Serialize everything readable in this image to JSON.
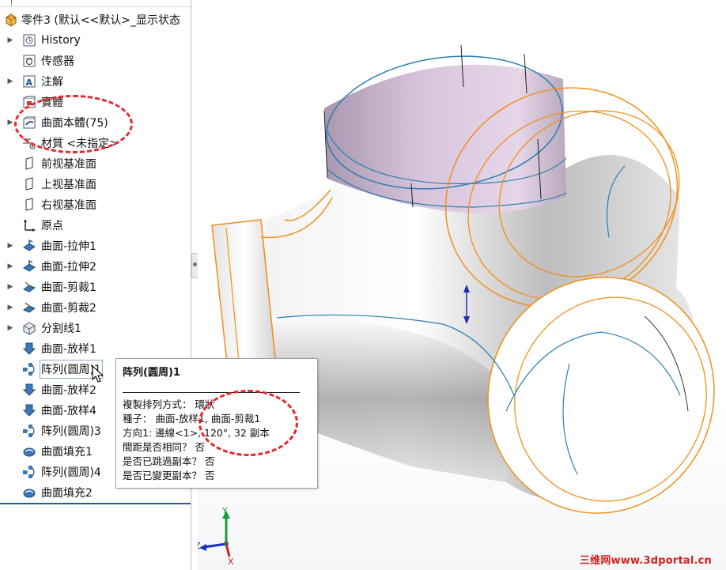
{
  "tree": {
    "root_label": "零件3  (默认<<默认>_显示状态",
    "items": [
      {
        "label": "History",
        "expandable": true,
        "icon": "history-icon"
      },
      {
        "label": "传感器",
        "expandable": false,
        "icon": "sensor-icon"
      },
      {
        "label": "注解",
        "expandable": true,
        "icon": "annotation-icon"
      },
      {
        "label": "實體",
        "expandable": false,
        "icon": "solid-bodies-icon"
      },
      {
        "label": "曲面本體(75)",
        "expandable": true,
        "icon": "surface-bodies-icon"
      },
      {
        "label": "材質 <未指定>",
        "expandable": false,
        "icon": "material-icon"
      },
      {
        "label": "前视基准面",
        "expandable": false,
        "icon": "plane-icon"
      },
      {
        "label": "上视基准面",
        "expandable": false,
        "icon": "plane-icon"
      },
      {
        "label": "右视基准面",
        "expandable": false,
        "icon": "plane-icon"
      },
      {
        "label": "原点",
        "expandable": false,
        "icon": "origin-icon"
      },
      {
        "label": "曲面-拉伸1",
        "expandable": true,
        "icon": "surface-extrude-icon"
      },
      {
        "label": "曲面-拉伸2",
        "expandable": true,
        "icon": "surface-extrude-icon"
      },
      {
        "label": "曲面-剪裁1",
        "expandable": true,
        "icon": "surface-trim-icon"
      },
      {
        "label": "曲面-剪裁2",
        "expandable": true,
        "icon": "surface-trim-icon"
      },
      {
        "label": "分割线1",
        "expandable": true,
        "icon": "split-line-icon"
      },
      {
        "label": "曲面-放样1",
        "expandable": false,
        "icon": "surface-loft-icon"
      },
      {
        "label": "阵列(圆周)1",
        "expandable": false,
        "icon": "circular-pattern-icon"
      },
      {
        "label": "曲面-放样2",
        "expandable": false,
        "icon": "surface-loft-icon"
      },
      {
        "label": "曲面-放样4",
        "expandable": false,
        "icon": "surface-loft-icon"
      },
      {
        "label": "阵列(圆周)3",
        "expandable": false,
        "icon": "circular-pattern-icon"
      },
      {
        "label": "曲面填充1",
        "expandable": false,
        "icon": "surface-fill-icon"
      },
      {
        "label": "阵列(圆周)4",
        "expandable": false,
        "icon": "circular-pattern-icon"
      },
      {
        "label": "曲面填充2",
        "expandable": false,
        "icon": "surface-fill-icon"
      }
    ]
  },
  "tooltip": {
    "title": "阵列(圆周)1",
    "lines": [
      "複製排列方式： 環狀",
      "種子： 曲面-放样1, 曲面-剪裁1",
      "方向1: 邊線<1>, 120°, 32 副本",
      "間距是否相同？ 否",
      "是否已跳過副本？ 否",
      "是否已變更副本？ 否"
    ]
  },
  "triad": {
    "x": "X",
    "y": "Y",
    "z": "Z"
  },
  "watermark": "三维网www.3dportal.cn",
  "colors": {
    "edge_orange": "#f0901c",
    "edge_blue": "#2a7fb0",
    "annotation_red": "#e8262c",
    "watermark_red": "#d8201f"
  }
}
